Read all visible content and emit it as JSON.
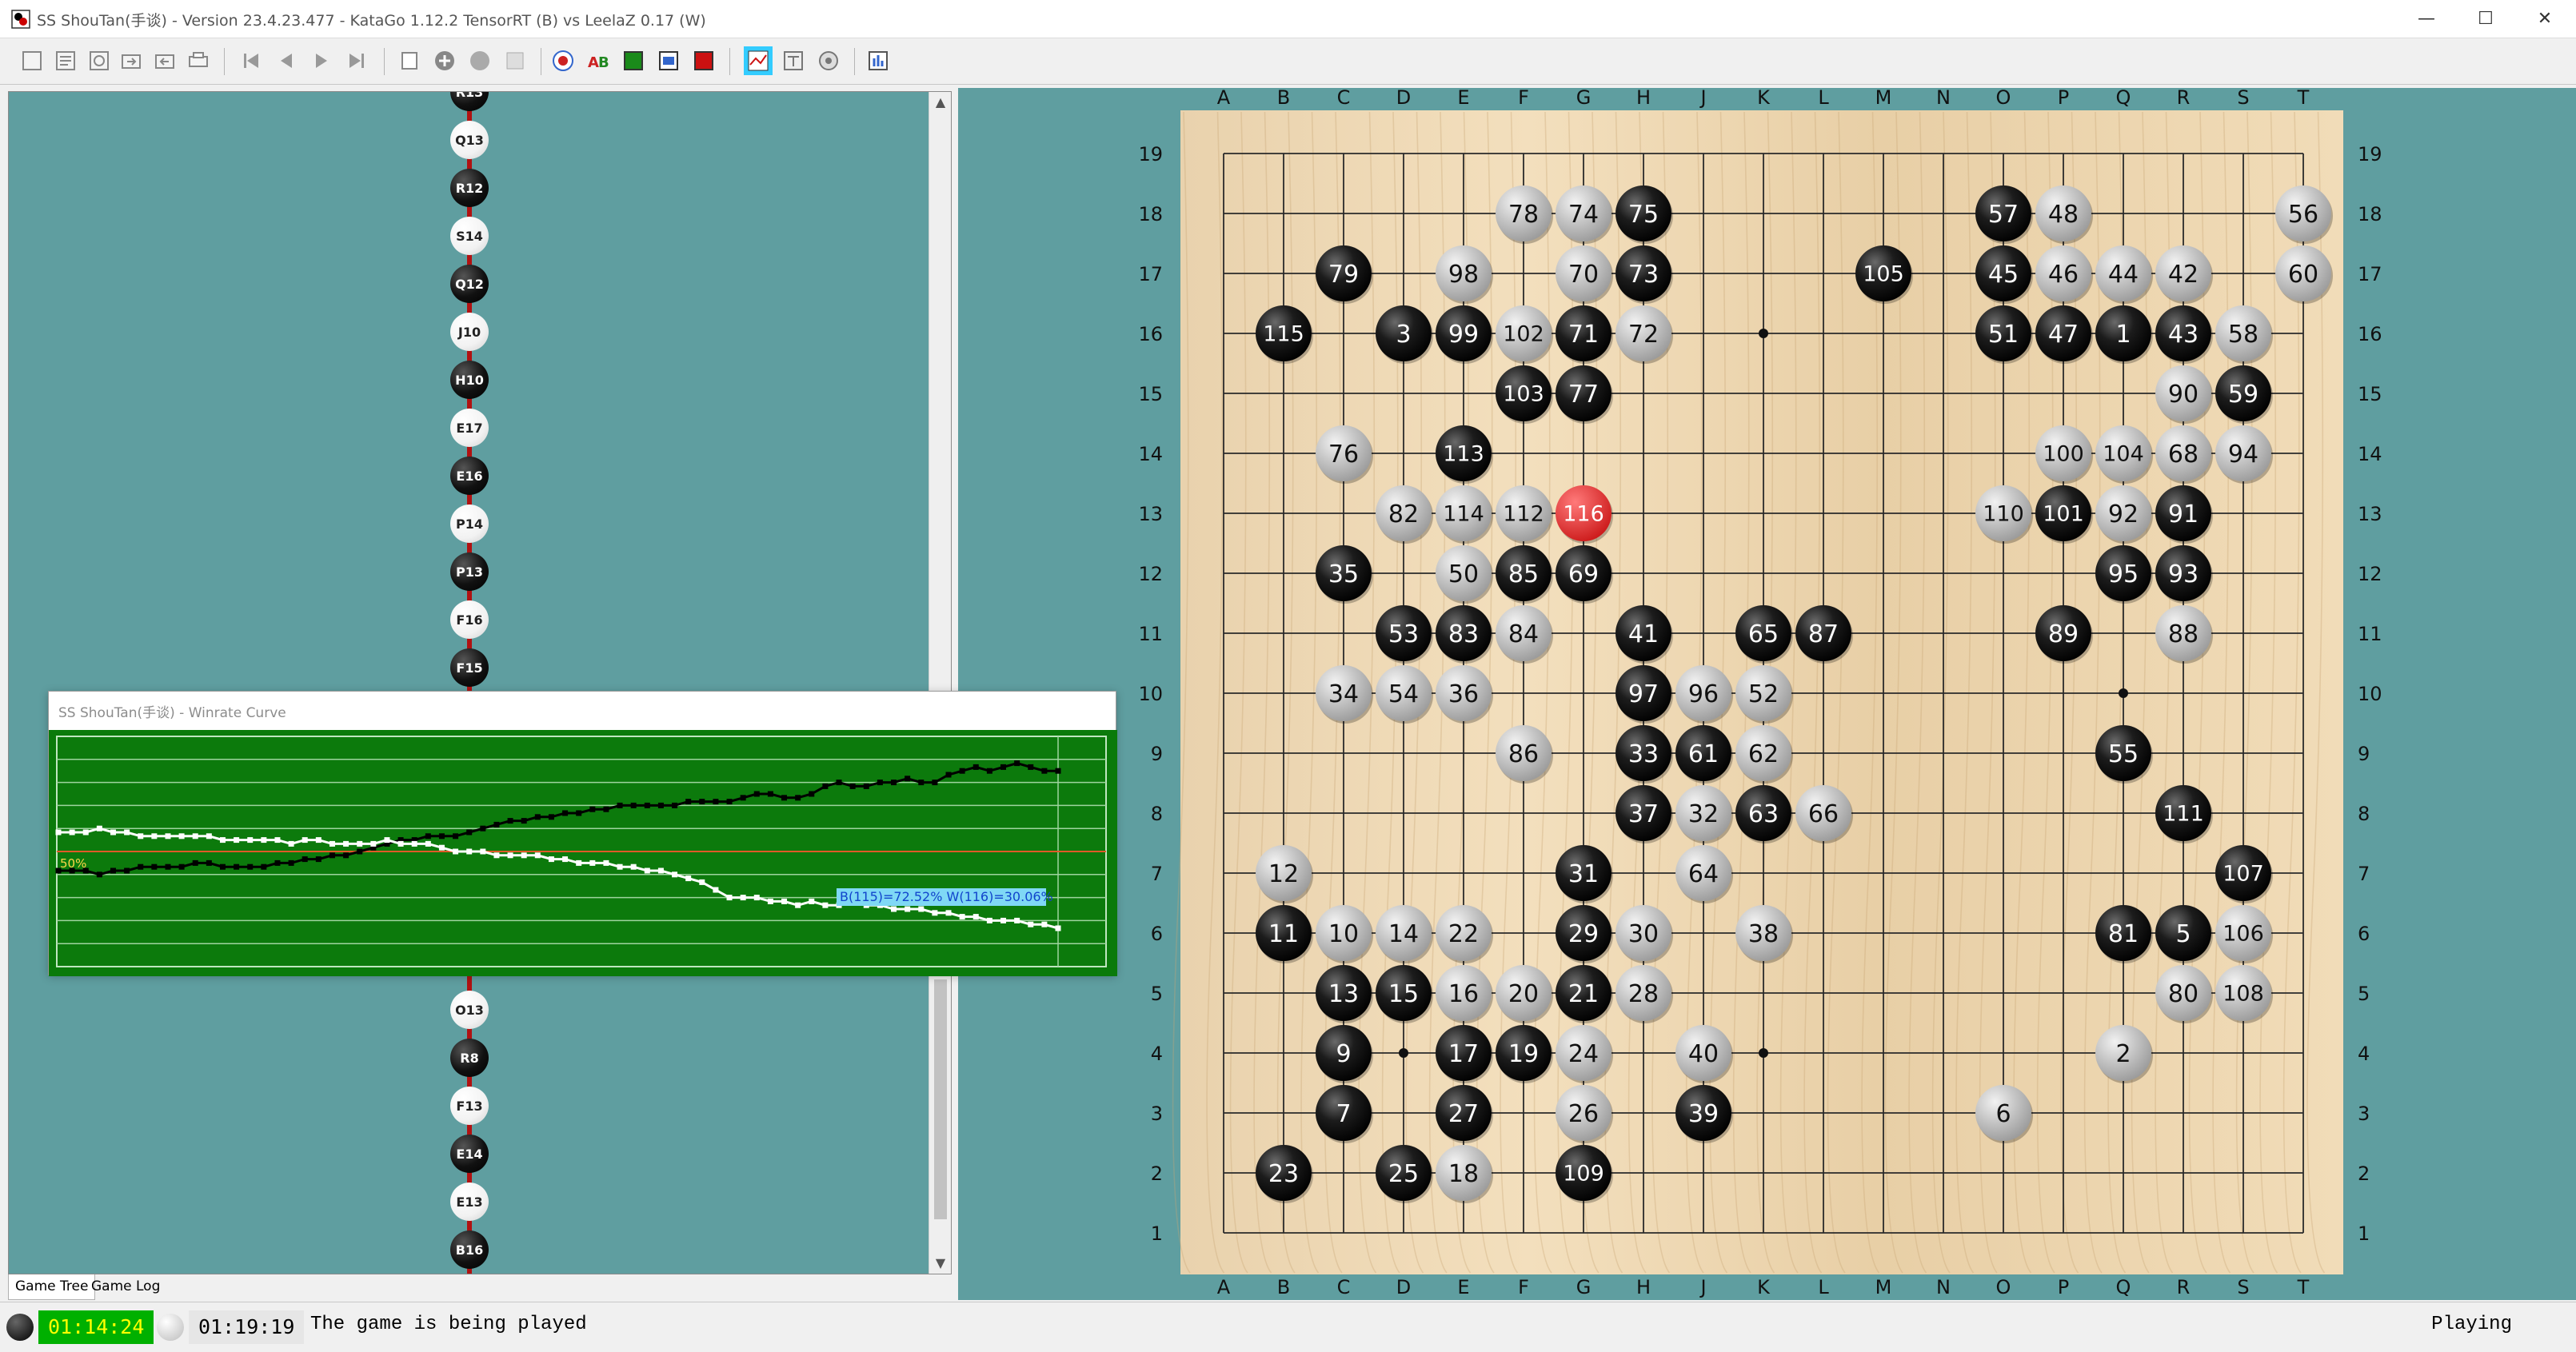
{
  "window": {
    "title": "SS ShouTan(手谈) - Version 23.4.23.477 - KataGo 1.12.2 TensorRT (B) vs LeelaZ 0.17 (W)",
    "minimize": "—",
    "maximize": "☐",
    "close": "✕"
  },
  "toolbar": {
    "buttons": [
      {
        "name": "new-game"
      },
      {
        "name": "open-file"
      },
      {
        "name": "save-file"
      },
      {
        "name": "import"
      },
      {
        "name": "export"
      },
      {
        "name": "print"
      },
      {
        "name": "first-move"
      },
      {
        "name": "previous-move"
      },
      {
        "name": "next-move"
      },
      {
        "name": "last-move"
      },
      {
        "name": "pass"
      },
      {
        "name": "add-stone"
      },
      {
        "name": "remove-stone"
      },
      {
        "name": "blank"
      },
      {
        "name": "analysis"
      },
      {
        "name": "labels"
      },
      {
        "name": "board-view"
      },
      {
        "name": "screenshot"
      },
      {
        "name": "engine"
      },
      {
        "name": "winrate-curve"
      },
      {
        "name": "estimate"
      },
      {
        "name": "settings"
      },
      {
        "name": "info"
      }
    ]
  },
  "game_tree": {
    "top_nodes": [
      {
        "label": "R13",
        "color": "b"
      },
      {
        "label": "Q13",
        "color": "w"
      },
      {
        "label": "R12",
        "color": "b"
      },
      {
        "label": "S14",
        "color": "w"
      },
      {
        "label": "Q12",
        "color": "b"
      },
      {
        "label": "J10",
        "color": "w"
      },
      {
        "label": "H10",
        "color": "b"
      },
      {
        "label": "E17",
        "color": "w"
      },
      {
        "label": "E16",
        "color": "b"
      },
      {
        "label": "P14",
        "color": "w"
      },
      {
        "label": "P13",
        "color": "b"
      },
      {
        "label": "F16",
        "color": "w"
      },
      {
        "label": "F15",
        "color": "b"
      }
    ],
    "bottom_nodes": [
      {
        "label": "O13",
        "color": "w"
      },
      {
        "label": "R8",
        "color": "b"
      },
      {
        "label": "F13",
        "color": "w"
      },
      {
        "label": "E14",
        "color": "b"
      },
      {
        "label": "E13",
        "color": "w"
      },
      {
        "label": "B16",
        "color": "b"
      }
    ]
  },
  "tabs": {
    "game_tree": "Game Tree",
    "game_log": "Game Log"
  },
  "winrate": {
    "title": "SS ShouTan(手谈) - Winrate Curve",
    "fifty_label": "50%",
    "readout": "B(115)=72.52% W(116)=30.06%",
    "black_series": [
      45,
      45,
      45,
      44,
      45,
      45,
      46,
      46,
      46,
      46,
      47,
      47,
      46,
      46,
      46,
      46,
      47,
      47,
      48,
      48,
      49,
      49,
      50,
      51,
      52,
      53,
      53,
      54,
      54,
      54,
      55,
      56,
      57,
      58,
      58,
      59,
      59,
      60,
      60,
      61,
      61,
      62,
      62,
      62,
      62,
      62,
      63,
      63,
      63,
      63,
      64,
      65,
      65,
      64,
      64,
      65,
      67,
      68,
      67,
      67,
      68,
      68,
      69,
      68,
      68,
      70,
      71,
      72,
      71,
      72,
      73,
      72,
      71,
      71
    ],
    "white_series": [
      55,
      55,
      55,
      56,
      55,
      55,
      54,
      54,
      54,
      54,
      54,
      54,
      53,
      53,
      53,
      53,
      53,
      52,
      53,
      53,
      52,
      52,
      52,
      52,
      53,
      52,
      52,
      52,
      51,
      50,
      50,
      50,
      49,
      49,
      49,
      49,
      48,
      48,
      47,
      47,
      47,
      46,
      46,
      45,
      45,
      44,
      43,
      42,
      40,
      38,
      38,
      38,
      37,
      37,
      36,
      37,
      36,
      36,
      37,
      36,
      36,
      35,
      35,
      35,
      34,
      34,
      33,
      33,
      32,
      32,
      32,
      31,
      31,
      30
    ]
  },
  "board": {
    "columns": [
      "A",
      "B",
      "C",
      "D",
      "E",
      "F",
      "G",
      "H",
      "J",
      "K",
      "L",
      "M",
      "N",
      "O",
      "P",
      "Q",
      "R",
      "S",
      "T"
    ],
    "rows": [
      "19",
      "18",
      "17",
      "16",
      "15",
      "14",
      "13",
      "12",
      "11",
      "10",
      "9",
      "8",
      "7",
      "6",
      "5",
      "4",
      "3",
      "2",
      "1"
    ],
    "last_move": "116",
    "stones": [
      {
        "c": "O",
        "r": 18,
        "n": "57",
        "s": "b"
      },
      {
        "c": "P",
        "r": 18,
        "n": "48",
        "s": "w"
      },
      {
        "c": "T",
        "r": 18,
        "n": "56",
        "s": "w"
      },
      {
        "c": "F",
        "r": 18,
        "n": "78",
        "s": "w"
      },
      {
        "c": "G",
        "r": 18,
        "n": "74",
        "s": "w"
      },
      {
        "c": "H",
        "r": 18,
        "n": "75",
        "s": "b"
      },
      {
        "c": "C",
        "r": 17,
        "n": "79",
        "s": "b"
      },
      {
        "c": "E",
        "r": 17,
        "n": "98",
        "s": "w"
      },
      {
        "c": "G",
        "r": 17,
        "n": "70",
        "s": "w"
      },
      {
        "c": "H",
        "r": 17,
        "n": "73",
        "s": "b"
      },
      {
        "c": "M",
        "r": 17,
        "n": "105",
        "s": "b"
      },
      {
        "c": "O",
        "r": 17,
        "n": "45",
        "s": "b"
      },
      {
        "c": "P",
        "r": 17,
        "n": "46",
        "s": "w"
      },
      {
        "c": "Q",
        "r": 17,
        "n": "44",
        "s": "w"
      },
      {
        "c": "R",
        "r": 17,
        "n": "42",
        "s": "w"
      },
      {
        "c": "T",
        "r": 17,
        "n": "60",
        "s": "w"
      },
      {
        "c": "B",
        "r": 16,
        "n": "115",
        "s": "b"
      },
      {
        "c": "D",
        "r": 16,
        "n": "3",
        "s": "b"
      },
      {
        "c": "E",
        "r": 16,
        "n": "99",
        "s": "b"
      },
      {
        "c": "F",
        "r": 16,
        "n": "102",
        "s": "w"
      },
      {
        "c": "G",
        "r": 16,
        "n": "71",
        "s": "b"
      },
      {
        "c": "H",
        "r": 16,
        "n": "72",
        "s": "w"
      },
      {
        "c": "O",
        "r": 16,
        "n": "51",
        "s": "b"
      },
      {
        "c": "P",
        "r": 16,
        "n": "47",
        "s": "b"
      },
      {
        "c": "Q",
        "r": 16,
        "n": "1",
        "s": "b"
      },
      {
        "c": "R",
        "r": 16,
        "n": "43",
        "s": "b"
      },
      {
        "c": "S",
        "r": 16,
        "n": "58",
        "s": "w"
      },
      {
        "c": "F",
        "r": 15,
        "n": "103",
        "s": "b"
      },
      {
        "c": "G",
        "r": 15,
        "n": "77",
        "s": "b"
      },
      {
        "c": "R",
        "r": 15,
        "n": "90",
        "s": "w"
      },
      {
        "c": "S",
        "r": 15,
        "n": "59",
        "s": "b"
      },
      {
        "c": "C",
        "r": 14,
        "n": "76",
        "s": "w"
      },
      {
        "c": "E",
        "r": 14,
        "n": "113",
        "s": "b"
      },
      {
        "c": "P",
        "r": 14,
        "n": "100",
        "s": "w"
      },
      {
        "c": "Q",
        "r": 14,
        "n": "104",
        "s": "w"
      },
      {
        "c": "R",
        "r": 14,
        "n": "68",
        "s": "w"
      },
      {
        "c": "S",
        "r": 14,
        "n": "94",
        "s": "w"
      },
      {
        "c": "D",
        "r": 13,
        "n": "82",
        "s": "w"
      },
      {
        "c": "E",
        "r": 13,
        "n": "114",
        "s": "w"
      },
      {
        "c": "F",
        "r": 13,
        "n": "112",
        "s": "w"
      },
      {
        "c": "G",
        "r": 13,
        "n": "116",
        "s": "r"
      },
      {
        "c": "O",
        "r": 13,
        "n": "110",
        "s": "w"
      },
      {
        "c": "P",
        "r": 13,
        "n": "101",
        "s": "b"
      },
      {
        "c": "Q",
        "r": 13,
        "n": "92",
        "s": "w"
      },
      {
        "c": "R",
        "r": 13,
        "n": "91",
        "s": "b"
      },
      {
        "c": "C",
        "r": 12,
        "n": "35",
        "s": "b"
      },
      {
        "c": "E",
        "r": 12,
        "n": "50",
        "s": "w"
      },
      {
        "c": "F",
        "r": 12,
        "n": "85",
        "s": "b"
      },
      {
        "c": "G",
        "r": 12,
        "n": "69",
        "s": "b"
      },
      {
        "c": "Q",
        "r": 12,
        "n": "95",
        "s": "b"
      },
      {
        "c": "R",
        "r": 12,
        "n": "93",
        "s": "b"
      },
      {
        "c": "D",
        "r": 11,
        "n": "53",
        "s": "b"
      },
      {
        "c": "E",
        "r": 11,
        "n": "83",
        "s": "b"
      },
      {
        "c": "F",
        "r": 11,
        "n": "84",
        "s": "w"
      },
      {
        "c": "H",
        "r": 11,
        "n": "41",
        "s": "b"
      },
      {
        "c": "K",
        "r": 11,
        "n": "65",
        "s": "b"
      },
      {
        "c": "L",
        "r": 11,
        "n": "87",
        "s": "b"
      },
      {
        "c": "P",
        "r": 11,
        "n": "89",
        "s": "b"
      },
      {
        "c": "R",
        "r": 11,
        "n": "88",
        "s": "w"
      },
      {
        "c": "C",
        "r": 10,
        "n": "34",
        "s": "w"
      },
      {
        "c": "D",
        "r": 10,
        "n": "54",
        "s": "w"
      },
      {
        "c": "E",
        "r": 10,
        "n": "36",
        "s": "w"
      },
      {
        "c": "H",
        "r": 10,
        "n": "97",
        "s": "b"
      },
      {
        "c": "J",
        "r": 10,
        "n": "96",
        "s": "w"
      },
      {
        "c": "K",
        "r": 10,
        "n": "52",
        "s": "w"
      },
      {
        "c": "F",
        "r": 9,
        "n": "86",
        "s": "w"
      },
      {
        "c": "H",
        "r": 9,
        "n": "33",
        "s": "b"
      },
      {
        "c": "J",
        "r": 9,
        "n": "61",
        "s": "b"
      },
      {
        "c": "K",
        "r": 9,
        "n": "62",
        "s": "w"
      },
      {
        "c": "Q",
        "r": 9,
        "n": "55",
        "s": "b"
      },
      {
        "c": "H",
        "r": 8,
        "n": "37",
        "s": "b"
      },
      {
        "c": "J",
        "r": 8,
        "n": "32",
        "s": "w"
      },
      {
        "c": "K",
        "r": 8,
        "n": "63",
        "s": "b"
      },
      {
        "c": "L",
        "r": 8,
        "n": "66",
        "s": "w"
      },
      {
        "c": "R",
        "r": 8,
        "n": "111",
        "s": "b"
      },
      {
        "c": "B",
        "r": 7,
        "n": "12",
        "s": "w"
      },
      {
        "c": "G",
        "r": 7,
        "n": "31",
        "s": "b"
      },
      {
        "c": "J",
        "r": 7,
        "n": "64",
        "s": "w"
      },
      {
        "c": "S",
        "r": 7,
        "n": "107",
        "s": "b"
      },
      {
        "c": "B",
        "r": 6,
        "n": "11",
        "s": "b"
      },
      {
        "c": "C",
        "r": 6,
        "n": "10",
        "s": "w"
      },
      {
        "c": "D",
        "r": 6,
        "n": "14",
        "s": "w"
      },
      {
        "c": "E",
        "r": 6,
        "n": "22",
        "s": "w"
      },
      {
        "c": "G",
        "r": 6,
        "n": "29",
        "s": "b"
      },
      {
        "c": "H",
        "r": 6,
        "n": "30",
        "s": "w"
      },
      {
        "c": "K",
        "r": 6,
        "n": "38",
        "s": "w"
      },
      {
        "c": "Q",
        "r": 6,
        "n": "81",
        "s": "b"
      },
      {
        "c": "R",
        "r": 6,
        "n": "5",
        "s": "b"
      },
      {
        "c": "S",
        "r": 6,
        "n": "106",
        "s": "w"
      },
      {
        "c": "C",
        "r": 5,
        "n": "13",
        "s": "b"
      },
      {
        "c": "D",
        "r": 5,
        "n": "15",
        "s": "b"
      },
      {
        "c": "E",
        "r": 5,
        "n": "16",
        "s": "w"
      },
      {
        "c": "F",
        "r": 5,
        "n": "20",
        "s": "w"
      },
      {
        "c": "G",
        "r": 5,
        "n": "21",
        "s": "b"
      },
      {
        "c": "H",
        "r": 5,
        "n": "28",
        "s": "w"
      },
      {
        "c": "R",
        "r": 5,
        "n": "80",
        "s": "w"
      },
      {
        "c": "S",
        "r": 5,
        "n": "108",
        "s": "w"
      },
      {
        "c": "C",
        "r": 4,
        "n": "9",
        "s": "b"
      },
      {
        "c": "E",
        "r": 4,
        "n": "17",
        "s": "b"
      },
      {
        "c": "F",
        "r": 4,
        "n": "19",
        "s": "b"
      },
      {
        "c": "G",
        "r": 4,
        "n": "24",
        "s": "w"
      },
      {
        "c": "J",
        "r": 4,
        "n": "40",
        "s": "w"
      },
      {
        "c": "Q",
        "r": 4,
        "n": "2",
        "s": "w"
      },
      {
        "c": "C",
        "r": 3,
        "n": "7",
        "s": "b"
      },
      {
        "c": "E",
        "r": 3,
        "n": "27",
        "s": "b"
      },
      {
        "c": "G",
        "r": 3,
        "n": "26",
        "s": "w"
      },
      {
        "c": "J",
        "r": 3,
        "n": "39",
        "s": "b"
      },
      {
        "c": "O",
        "r": 3,
        "n": "6",
        "s": "w"
      },
      {
        "c": "B",
        "r": 2,
        "n": "23",
        "s": "b"
      },
      {
        "c": "D",
        "r": 2,
        "n": "25",
        "s": "b"
      },
      {
        "c": "E",
        "r": 2,
        "n": "18",
        "s": "w"
      },
      {
        "c": "G",
        "r": 2,
        "n": "109",
        "s": "b"
      }
    ]
  },
  "status": {
    "black_clock": "01:14:24",
    "white_clock": "01:19:19",
    "message": "The game is being played",
    "state": "Playing"
  }
}
